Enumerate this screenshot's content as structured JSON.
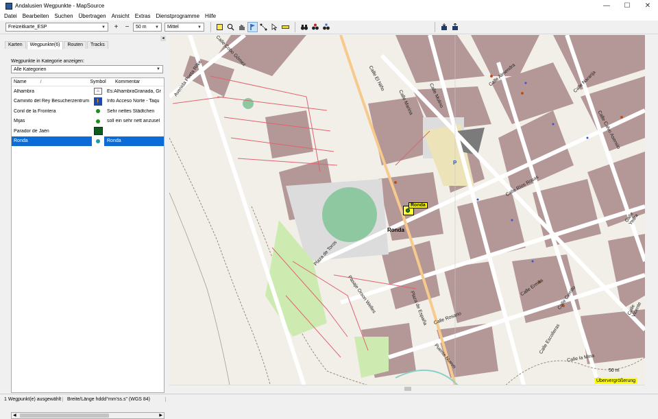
{
  "window": {
    "title": "Andalusien Wegpunkte - MapSource"
  },
  "window_controls": {
    "minimize": "—",
    "maximize": "☐",
    "close": "✕"
  },
  "menu": [
    "Datei",
    "Bearbeiten",
    "Suchen",
    "Übertragen",
    "Ansicht",
    "Extras",
    "Dienstprogramme",
    "Hilfe"
  ],
  "toolbar": {
    "map_product": "Freizeitkarte_ESP",
    "zoom_scale": "50 m",
    "detail_level": "Mittel",
    "zoom_in_icon": "+",
    "zoom_out_icon": "−"
  },
  "tabs": [
    "Karten",
    "Wegpunkte(6)",
    "Routen",
    "Tracks"
  ],
  "waypoints_panel": {
    "category_label": "Wegpunkte in Kategorie anzeigen:",
    "category_value": "Alle Kategorien",
    "columns": {
      "name": "Name",
      "sort_marker": "/",
      "symbol": "Symbol",
      "comment": "Kommentar"
    },
    "rows": [
      {
        "name": "Alhambra",
        "symbol": "museum-icon",
        "comment": "Es:AlhambraGranada, Gr"
      },
      {
        "name": "Caminito del Rey Besucherzentrum",
        "symbol": "hiker-icon",
        "comment": "Info Acceso Norte - Taqu"
      },
      {
        "name": "Conil de la Frontera",
        "symbol": "green-dot-icon",
        "comment": "Sehr nettes Städtchen"
      },
      {
        "name": "Mijas",
        "symbol": "green-dot-icon",
        "comment": "soll ein sehr nett anzusel"
      },
      {
        "name": "Parador de Jaén",
        "symbol": "park-icon",
        "comment": ""
      },
      {
        "name": "Ronda",
        "symbol": "green-dot-icon",
        "comment": "Ronda"
      }
    ],
    "selected_index": 5
  },
  "map": {
    "streets": [
      "Avenida Poeta Rilke",
      "Calle Cobo Gómez",
      "Calle El Niño",
      "Calle Marina",
      "Calle Molino",
      "Calle Almendra",
      "Calle Naranja",
      "Calle Calvo Asensio",
      "Calle Ríos Rosas",
      "Calle Yedra",
      "Plaza de Toros",
      "Pasaje Orson Welles",
      "Plaza de España",
      "Calle Rosario",
      "Calle Ermita",
      "Calle Cerrillo",
      "Calle Vicente",
      "Calle Escolleras",
      "Calle la Mina",
      "Puente Nuevo"
    ],
    "place_label": "Ronda",
    "waypoint_label": "Ronda",
    "parking_label": "P",
    "scale_label": "50 m",
    "zoom_notice": "Übervergrößerung",
    "colors": {
      "background": "#f2efe9",
      "building": "#b49797",
      "path": "#e0626f",
      "pitch": "#8dc8a1",
      "park": "#cdebb0",
      "road": "#ffffff",
      "main_road": "#f6c98c"
    }
  },
  "status": {
    "selection": "1 Wegpunkt(e) ausgewählt",
    "coordinate_format": "Breite/Länge hddd°mm'ss.s\" (WGS 84)"
  }
}
